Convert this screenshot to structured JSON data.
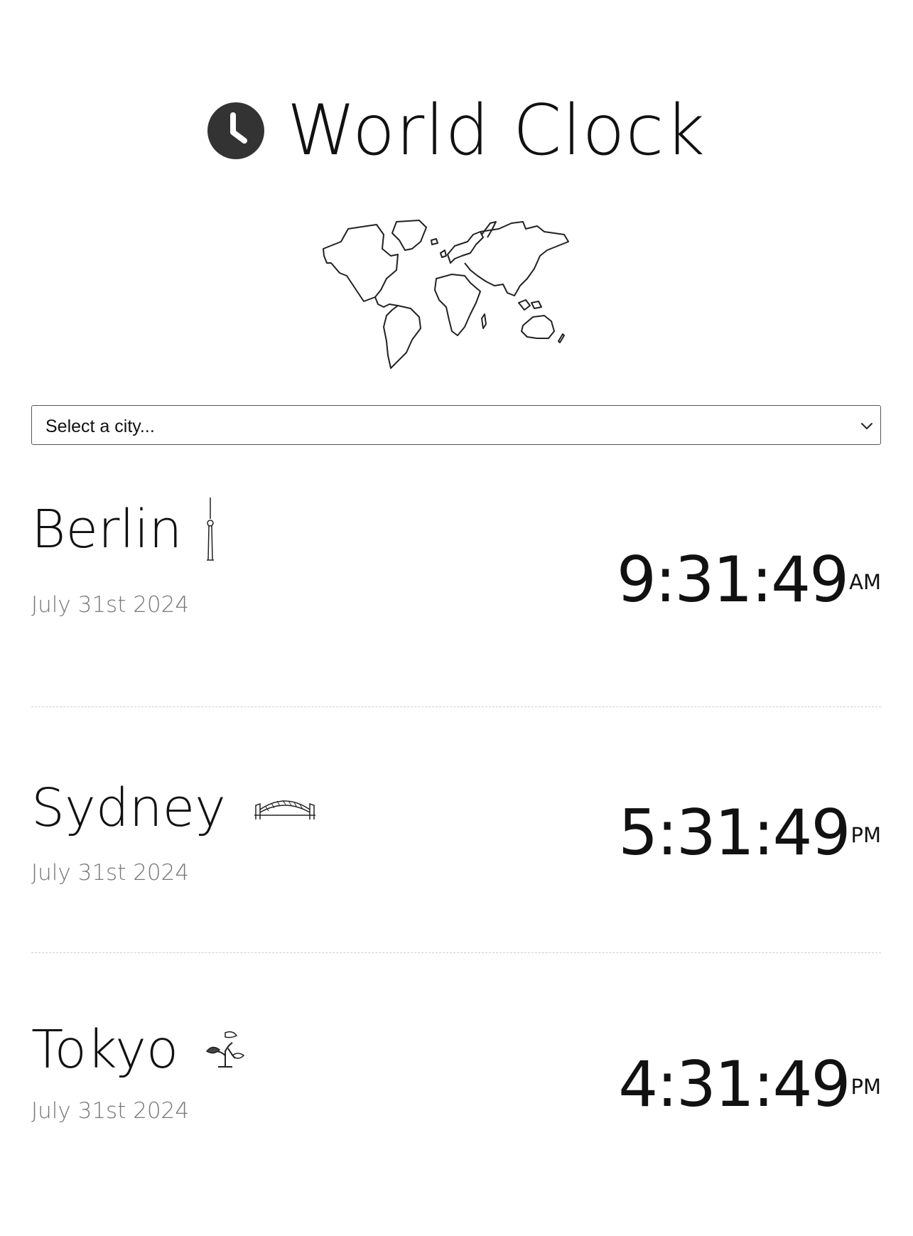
{
  "header": {
    "title": "World Clock",
    "icon": "clock-icon"
  },
  "map": {
    "icon": "world-map-illustration"
  },
  "city_select": {
    "selected": "Select a city...",
    "icon": "chevron-down-icon"
  },
  "cities": [
    {
      "name": "Berlin",
      "date": "July 31st 2024",
      "time": "9:31:49",
      "ampm": "AM",
      "landmark_icon": "tv-tower-icon"
    },
    {
      "name": "Sydney",
      "date": "July 31st 2024",
      "time": "5:31:49",
      "ampm": "PM",
      "landmark_icon": "harbour-bridge-icon"
    },
    {
      "name": "Tokyo",
      "date": "July 31st 2024",
      "time": "4:31:49",
      "ampm": "PM",
      "landmark_icon": "bonsai-tree-icon"
    }
  ],
  "colors": {
    "text": "#111111",
    "date_text": "#777777",
    "divider": "#cfcfcf",
    "icon_fill": "#333333"
  }
}
